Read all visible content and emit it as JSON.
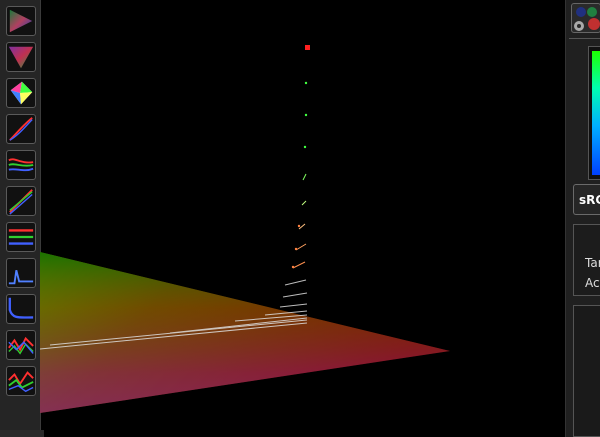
{
  "toolbar": {
    "tools": [
      {
        "name": "view-gamut-icon"
      },
      {
        "name": "view-triangle-icon"
      },
      {
        "name": "view-3d-gamut-icon"
      },
      {
        "name": "tone-curve-icon"
      },
      {
        "name": "rgb-balance-icon"
      },
      {
        "name": "rgb-curves-icon"
      },
      {
        "name": "rgb-levels-icon"
      },
      {
        "name": "luminance-graph-icon"
      },
      {
        "name": "blue-response-icon"
      },
      {
        "name": "rgb-error-graph-icon"
      },
      {
        "name": "rgb-mixed-graph-icon"
      }
    ]
  },
  "viewport": {
    "colors": {
      "red": "#8a0000",
      "green": "#007000",
      "magenta": "#8a2a7a"
    }
  },
  "panel": {
    "settings_icon": "gear-icon",
    "profile_label": "sRGB",
    "info": {
      "target_label": "Target",
      "actual_label": "Actual"
    },
    "color_bar_colors": [
      "#1dff00",
      "#00ffb0",
      "#00b0ff",
      "#0040ff"
    ]
  }
}
